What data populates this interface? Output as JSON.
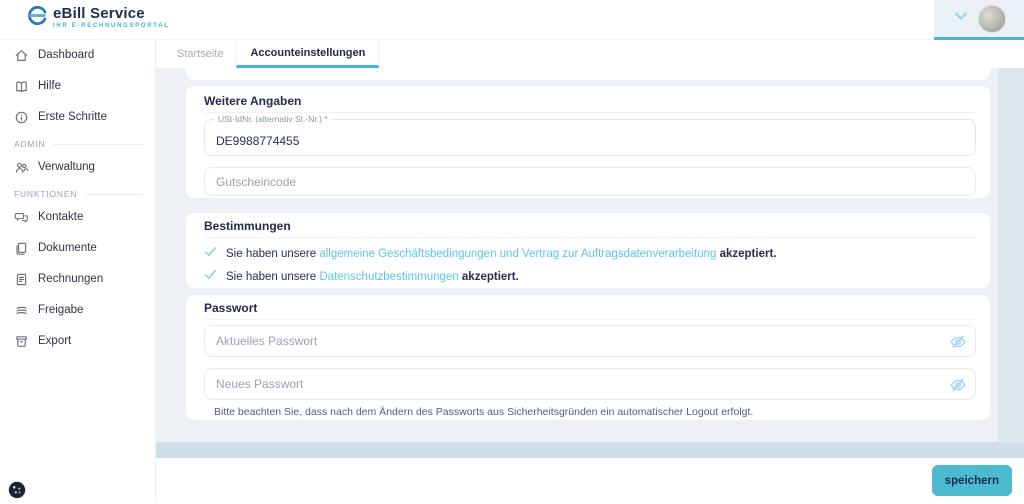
{
  "brand": {
    "name": "eBill Service",
    "tagline": "IHR E-RECHNUNGSPORTAL",
    "logo_icon": "ebill-logo-icon"
  },
  "header": {
    "user_menu_icons": [
      "chevron-down-icon",
      "avatar"
    ]
  },
  "sidebar": {
    "items": [
      {
        "label": "Dashboard",
        "icon": "home-icon"
      },
      {
        "label": "Hilfe",
        "icon": "book-icon"
      },
      {
        "label": "Erste Schritte",
        "icon": "info-icon"
      },
      {
        "label": "Verwaltung",
        "icon": "users-icon"
      },
      {
        "label": "Kontakte",
        "icon": "chat-icon"
      },
      {
        "label": "Dokumente",
        "icon": "documents-icon"
      },
      {
        "label": "Rechnungen",
        "icon": "invoice-icon"
      },
      {
        "label": "Freigabe",
        "icon": "layers-icon"
      },
      {
        "label": "Export",
        "icon": "export-icon"
      }
    ],
    "sections": {
      "admin": "ADMIN",
      "funktionen": "FUNKTIONEN"
    }
  },
  "tabs": [
    {
      "label": "Startseite",
      "active": false
    },
    {
      "label": "Accounteinstellungen",
      "active": true
    }
  ],
  "form": {
    "weitere_angaben": {
      "heading": "Weitere Angaben",
      "ust_label": "USt-IdNr. (alternativ St.-Nr.) *",
      "ust_value": "DE9988774455",
      "gutschein_placeholder": "Gutscheincode"
    },
    "bestimmungen": {
      "heading": "Bestimmungen",
      "rows": [
        {
          "prefix": "Sie haben unsere ",
          "link": "allgemeine Geschäftsbedingungen und Vertrag zur Auftragsdatenverarbeitung",
          "suffix": " akzeptiert."
        },
        {
          "prefix": "Sie haben unsere ",
          "link": "Datenschutzbestimmungen",
          "suffix": " akzeptiert."
        }
      ]
    },
    "passwort": {
      "heading": "Passwort",
      "current_placeholder": "Aktuelles Passwort",
      "new_placeholder": "Neues Passwort",
      "note": "Bitte beachten Sie, dass nach dem Ändern des Passworts aus Sicherheitsgründen ein automatischer Logout erfolgt."
    }
  },
  "footer": {
    "save_label": "speichern"
  },
  "colors": {
    "accent": "#45b8d8",
    "link": "#5ec6e4",
    "check": "#8ed4e8",
    "button": "#4cbacf",
    "content_bg": "#edf1f5"
  }
}
